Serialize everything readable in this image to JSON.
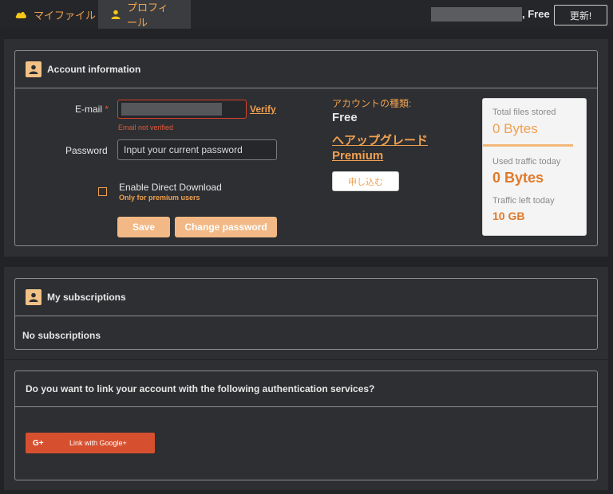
{
  "nav": {
    "my_files": "マイファイル",
    "profile": "プロフィール"
  },
  "header": {
    "plan_label": ", Free",
    "update_button": "更新!"
  },
  "account": {
    "title": "Account information",
    "email_label": "E-mail",
    "required_mark": "*",
    "verify_link": "Verify",
    "email_error": "Email not verified",
    "password_label": "Password",
    "password_placeholder": "Input your current password",
    "direct_download_label": "Enable Direct Download",
    "direct_download_note": "Only for premium users",
    "save_button": "Save",
    "change_password_button": "Change password",
    "account_type_label": "アカウントの種類:",
    "account_type_value": "Free",
    "upgrade_line1": "へアップグレード",
    "upgrade_line2": "Premium",
    "apply_button": "申し込む"
  },
  "stats": {
    "total_files_label": "Total files stored",
    "total_files_value": "0 Bytes",
    "used_traffic_label": "Used traffic today",
    "used_traffic_value": "0 Bytes",
    "traffic_left_label": "Traffic left today",
    "traffic_left_value": "10 GB"
  },
  "subscriptions": {
    "title": "My subscriptions",
    "empty_text": "No subscriptions"
  },
  "auth_services": {
    "question": "Do you want to link your account with the following authentication services?",
    "google_icon_text": "G+",
    "google_button": "Link with Google+"
  },
  "colors": {
    "accent": "#f0a050",
    "error": "#e05a3a",
    "google": "#d6502f"
  }
}
